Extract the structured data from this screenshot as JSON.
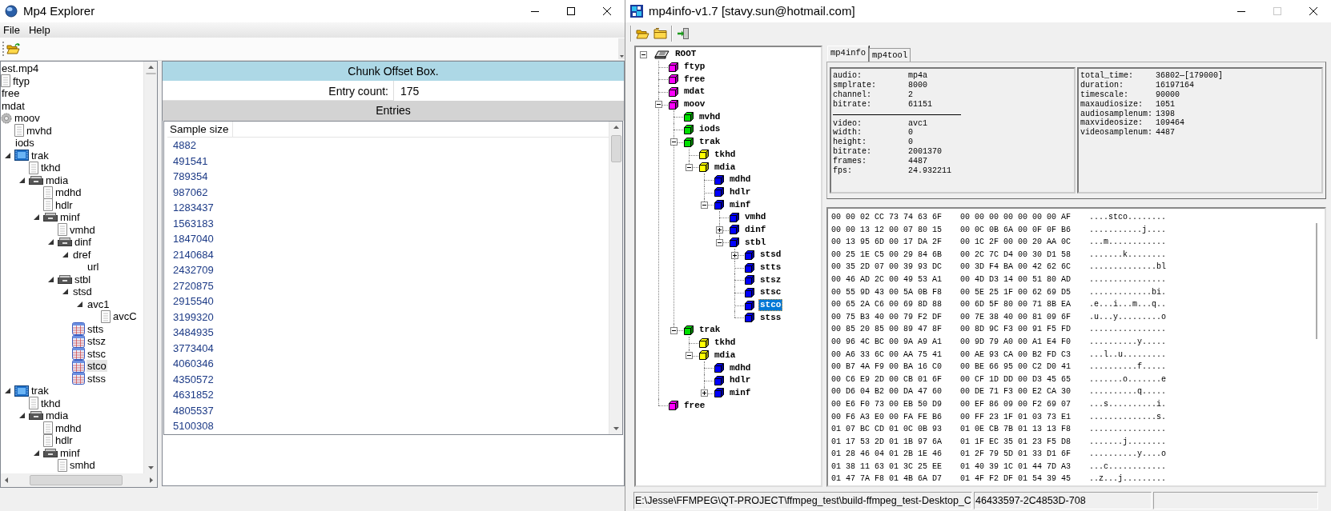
{
  "explorer": {
    "title": "Mp4 Explorer",
    "active": true,
    "menu": [
      "File",
      "Help"
    ],
    "tree": {
      "label": "est.mp4",
      "selected": false,
      "children": [
        {
          "label": "ftyp",
          "kind": "file",
          "selected": false
        },
        {
          "label": "free",
          "selected": false
        },
        {
          "label": "mdat",
          "selected": false
        },
        {
          "label": "moov",
          "kind": "gear",
          "selected": false,
          "children": [
            {
              "label": "mvhd",
              "kind": "file",
              "selected": false
            },
            {
              "label": "iods",
              "selected": false
            },
            {
              "label": "trak",
              "kind": "film",
              "expanded": true,
              "selected": false,
              "children": [
                {
                  "label": "tkhd",
                  "kind": "file",
                  "selected": false
                },
                {
                  "label": "mdia",
                  "kind": "drawer",
                  "expanded": true,
                  "selected": false,
                  "children": [
                    {
                      "label": "mdhd",
                      "kind": "file",
                      "selected": false
                    },
                    {
                      "label": "hdlr",
                      "kind": "file",
                      "selected": false
                    },
                    {
                      "label": "minf",
                      "kind": "drawer",
                      "expanded": true,
                      "selected": false,
                      "children": [
                        {
                          "label": "vmhd",
                          "kind": "file",
                          "selected": false
                        },
                        {
                          "label": "dinf",
                          "kind": "drawer",
                          "expanded": true,
                          "selected": false,
                          "children": [
                            {
                              "label": "dref",
                              "expanded": true,
                              "selected": false,
                              "children": [
                                {
                                  "label": "url",
                                  "selected": false
                                }
                              ]
                            }
                          ]
                        },
                        {
                          "label": "stbl",
                          "kind": "drawer",
                          "expanded": true,
                          "selected": false,
                          "children": [
                            {
                              "label": "stsd",
                              "expanded": true,
                              "selected": false,
                              "children": [
                                {
                                  "label": "avc1",
                                  "expanded": true,
                                  "selected": false,
                                  "children": [
                                    {
                                      "label": "avcC",
                                      "kind": "file",
                                      "selected": false
                                    }
                                  ]
                                }
                              ]
                            },
                            {
                              "label": "stts",
                              "kind": "grid",
                              "selected": false
                            },
                            {
                              "label": "stsz",
                              "kind": "grid",
                              "selected": false
                            },
                            {
                              "label": "stsc",
                              "kind": "grid",
                              "selected": false
                            },
                            {
                              "label": "stco",
                              "kind": "grid",
                              "selected": true
                            },
                            {
                              "label": "stss",
                              "kind": "grid",
                              "selected": false
                            }
                          ]
                        }
                      ]
                    }
                  ]
                }
              ]
            },
            {
              "label": "trak",
              "kind": "film",
              "expanded": true,
              "selected": false,
              "children": [
                {
                  "label": "tkhd",
                  "kind": "file",
                  "selected": false
                },
                {
                  "label": "mdia",
                  "kind": "drawer",
                  "expanded": true,
                  "selected": false,
                  "children": [
                    {
                      "label": "mdhd",
                      "kind": "file",
                      "selected": false
                    },
                    {
                      "label": "hdlr",
                      "kind": "file",
                      "selected": false
                    },
                    {
                      "label": "minf",
                      "kind": "drawer",
                      "expanded": true,
                      "selected": false,
                      "children": [
                        {
                          "label": "smhd",
                          "kind": "file",
                          "selected": false
                        }
                      ]
                    }
                  ]
                }
              ]
            }
          ]
        }
      ]
    },
    "box_title": "Chunk Offset Box.",
    "entry_count_label": "Entry count:",
    "entry_count": "175",
    "entries_heading": "Entries",
    "column": "Sample size",
    "values": [
      "4882",
      "491541",
      "789354",
      "987062",
      "1283437",
      "1563183",
      "1847040",
      "2140684",
      "2432709",
      "2720875",
      "2915540",
      "3199320",
      "3484935",
      "3773404",
      "4060346",
      "4350572",
      "4631852",
      "4805537",
      "5100308"
    ]
  },
  "mp4info": {
    "title": "mp4info-v1.7 [stavy.sun@hotmail.com]",
    "active": true,
    "maximize_disabled": true,
    "tree": {
      "label": "ROOT",
      "expanded": true,
      "selected": false,
      "children": [
        {
          "label": "ftyp",
          "selected": false
        },
        {
          "label": "free",
          "selected": false
        },
        {
          "label": "mdat",
          "selected": false
        },
        {
          "label": "moov",
          "expanded": true,
          "selected": false,
          "children": [
            {
              "label": "mvhd",
              "selected": false
            },
            {
              "label": "iods",
              "selected": false
            },
            {
              "label": "trak",
              "expanded": true,
              "selected": false,
              "children": [
                {
                  "label": "tkhd",
                  "selected": false
                },
                {
                  "label": "mdia",
                  "expanded": true,
                  "selected": false,
                  "children": [
                    {
                      "label": "mdhd",
                      "selected": false
                    },
                    {
                      "label": "hdlr",
                      "selected": false
                    },
                    {
                      "label": "minf",
                      "expanded": true,
                      "selected": false,
                      "children": [
                        {
                          "label": "vmhd",
                          "selected": false
                        },
                        {
                          "label": "dinf",
                          "expanded": false,
                          "selected": false
                        },
                        {
                          "label": "stbl",
                          "expanded": true,
                          "selected": false,
                          "children": [
                            {
                              "label": "stsd",
                              "expanded": false,
                              "selected": false
                            },
                            {
                              "label": "stts",
                              "selected": false
                            },
                            {
                              "label": "stsz",
                              "selected": false
                            },
                            {
                              "label": "stsc",
                              "selected": false
                            },
                            {
                              "label": "stco",
                              "selected": true
                            },
                            {
                              "label": "stss",
                              "selected": false
                            }
                          ]
                        }
                      ]
                    }
                  ]
                }
              ]
            },
            {
              "label": "trak",
              "expanded": true,
              "selected": false,
              "children": [
                {
                  "label": "tkhd",
                  "selected": false
                },
                {
                  "label": "mdia",
                  "expanded": true,
                  "selected": false,
                  "children": [
                    {
                      "label": "mdhd",
                      "selected": false
                    },
                    {
                      "label": "hdlr",
                      "selected": false
                    },
                    {
                      "label": "minf",
                      "expanded": false,
                      "selected": false
                    }
                  ]
                }
              ]
            }
          ]
        },
        {
          "label": "free",
          "selected": false
        }
      ]
    },
    "tabs": [
      {
        "label": "mp4info",
        "selected": true
      },
      {
        "label": "mp4tool",
        "selected": false
      }
    ],
    "audio": [
      {
        "label": "audio:",
        "value": "mp4a"
      },
      {
        "label": "smplrate:",
        "value": "8000"
      },
      {
        "label": "channel:",
        "value": "2"
      },
      {
        "label": "bitrate:",
        "value": "61151"
      }
    ],
    "video": [
      {
        "label": "video:",
        "value": "avc1"
      },
      {
        "label": "width:",
        "value": "0"
      },
      {
        "label": "height:",
        "value": "0"
      },
      {
        "label": "bitrate:",
        "value": "2001370"
      },
      {
        "label": "frames:",
        "value": "4487"
      },
      {
        "label": "fps:",
        "value": "24.932211"
      }
    ],
    "summary": [
      {
        "label": "total_time:",
        "value": "36802—[179000]"
      },
      {
        "label": "duration:",
        "value": "16197164"
      },
      {
        "label": "timescale:",
        "value": "90000"
      },
      {
        "label": "maxaudiosize:",
        "value": "1051"
      },
      {
        "label": "audiosamplenum:",
        "value": "1398"
      },
      {
        "label": "maxvideosize:",
        "value": "109464"
      },
      {
        "label": "videosamplenum:",
        "value": "4487"
      }
    ],
    "hex_rows": [
      {
        "hex_a": "00 00 02 CC 73 74 63 6F",
        "hex_b": "00 00 00 00 00 00 00 AF",
        "ascii": "....stco........"
      },
      {
        "hex_a": "00 00 13 12 00 07 80 15",
        "hex_b": "00 0C 0B 6A 00 0F 0F B6",
        "ascii": "...........j...."
      },
      {
        "hex_a": "00 13 95 6D 00 17 DA 2F",
        "hex_b": "00 1C 2F 00 00 20 AA 0C",
        "ascii": "...m............"
      },
      {
        "hex_a": "00 25 1E C5 00 29 84 6B",
        "hex_b": "00 2C 7C D4 00 30 D1 58",
        "ascii": ".......k........"
      },
      {
        "hex_a": "00 35 2D 07 00 39 93 DC",
        "hex_b": "00 3D F4 BA 00 42 62 6C",
        "ascii": "..............bl"
      },
      {
        "hex_a": "00 46 AD 2C 00 49 53 A1",
        "hex_b": "00 4D D3 14 00 51 80 AD",
        "ascii": "................"
      },
      {
        "hex_a": "00 55 9D 43 00 5A 0B F8",
        "hex_b": "00 5E 25 1F 00 62 69 D5",
        "ascii": ".............bi."
      },
      {
        "hex_a": "00 65 2A C6 00 69 8D 88",
        "hex_b": "00 6D 5F 80 00 71 8B EA",
        "ascii": ".e...i...m...q.."
      },
      {
        "hex_a": "00 75 B3 40 00 79 F2 DF",
        "hex_b": "00 7E 38 40 00 81 09 6F",
        "ascii": ".u...y.........o"
      },
      {
        "hex_a": "00 85 20 85 00 89 47 8F",
        "hex_b": "00 8D 9C F3 00 91 F5 FD",
        "ascii": "................"
      },
      {
        "hex_a": "00 96 4C BC 00 9A A9 A1",
        "hex_b": "00 9D 79 A0 00 A1 E4 F0",
        "ascii": "..........y....."
      },
      {
        "hex_a": "00 A6 33 6C 00 AA 75 41",
        "hex_b": "00 AE 93 CA 00 B2 FD C3",
        "ascii": "...l..u........."
      },
      {
        "hex_a": "00 B7 4A F9 00 BA 16 C0",
        "hex_b": "00 BE 66 95 00 C2 D0 41",
        "ascii": "..........f....."
      },
      {
        "hex_a": "00 C6 E9 2D 00 CB 01 6F",
        "hex_b": "00 CF 1D DD 00 D3 45 65",
        "ascii": ".......o.......e"
      },
      {
        "hex_a": "00 D6 04 B2 00 DA 47 60",
        "hex_b": "00 DE 71 F3 00 E2 CA 30",
        "ascii": "..........q....."
      },
      {
        "hex_a": "00 E6 F0 73 00 EB 50 D9",
        "hex_b": "00 EF 86 09 00 F2 69 07",
        "ascii": "...s..........i."
      },
      {
        "hex_a": "00 F6 A3 E0 00 FA FE B6",
        "hex_b": "00 FF 23 1F 01 03 73 E1",
        "ascii": "..............s."
      },
      {
        "hex_a": "01 07 BC CD 01 0C 0B 93",
        "hex_b": "01 0E CB 7B 01 13 13 F8",
        "ascii": "................"
      },
      {
        "hex_a": "01 17 53 2D 01 1B 97 6A",
        "hex_b": "01 1F EC 35 01 23 F5 D8",
        "ascii": ".......j........"
      },
      {
        "hex_a": "01 28 46 04 01 2B 1E 46",
        "hex_b": "01 2F 79 5D 01 33 D1 6F",
        "ascii": "..........y....o"
      },
      {
        "hex_a": "01 38 11 63 01 3C 25 EE",
        "hex_b": "01 40 39 1C 01 44 7D A3",
        "ascii": "...c............"
      },
      {
        "hex_a": "01 47 7A F8 01 4B 6A D7",
        "hex_b": "01 4F F2 DF 01 54 39 45",
        "ascii": "..z...j........."
      }
    ],
    "status_bar": [
      "E:\\Jesse\\FFMPEG\\QT-PROJECT\\ffmpeg_test\\build-ffmpeg_test-Desktop_C",
      "46433597-2C4853D-708"
    ]
  }
}
